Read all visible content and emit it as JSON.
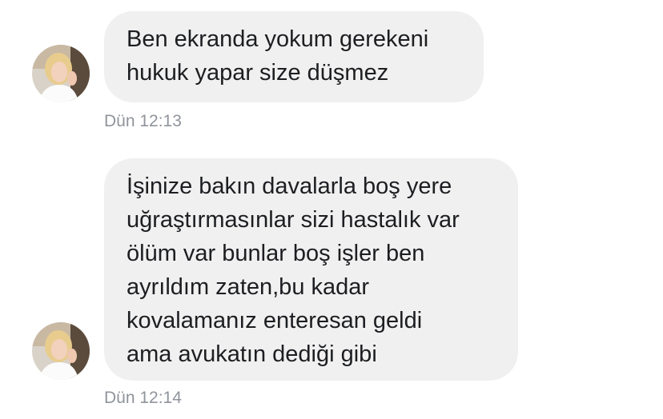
{
  "messages": [
    {
      "text": "Ben ekranda yokum gerekeni\nhukuk yapar size düşmez",
      "time": "Dün 12:13"
    },
    {
      "text": "İşinize bakın davalarla boş yere\nuğraştırmasınlar sizi hastalık var\nölüm var bunlar boş işler ben\nayrıldım zaten,bu kadar\nkovalamanız enteresan geldi\nama avukatın dediği gibi",
      "time": "Dün 12:14"
    }
  ],
  "colors": {
    "bubble": "#f1f0f0",
    "text": "#1c1e21",
    "timestamp": "#90949c"
  }
}
